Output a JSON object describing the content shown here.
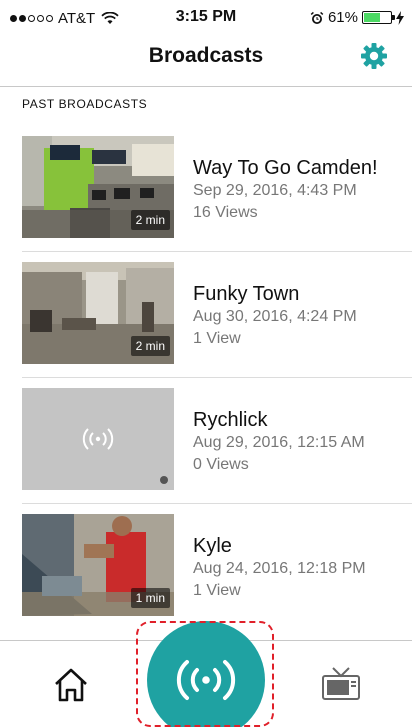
{
  "status_bar": {
    "carrier": "AT&T",
    "time": "3:15 PM",
    "battery": "61%",
    "battery_level": 0.61
  },
  "nav": {
    "title": "Broadcasts"
  },
  "section": {
    "header": "PAST BROADCASTS"
  },
  "broadcasts": [
    {
      "title": "Way To Go Camden!",
      "date": "Sep 29, 2016, 4:43 PM",
      "views": "16 Views",
      "duration": "2 min"
    },
    {
      "title": "Funky Town",
      "date": "Aug 30, 2016, 4:24 PM",
      "views": "1 View",
      "duration": "2 min"
    },
    {
      "title": "Rychlick",
      "date": "Aug 29, 2016, 12:15 AM",
      "views": "0 Views",
      "duration": ""
    },
    {
      "title": "Kyle",
      "date": "Aug 24, 2016, 12:18 PM",
      "views": "1 View",
      "duration": "1 min"
    }
  ],
  "colors": {
    "accent": "#1fa2a2",
    "battery": "#4cd964",
    "highlight": "#e0202a"
  },
  "icons": [
    "settings-gear-icon",
    "home-icon",
    "broadcast-icon",
    "tv-icon"
  ]
}
